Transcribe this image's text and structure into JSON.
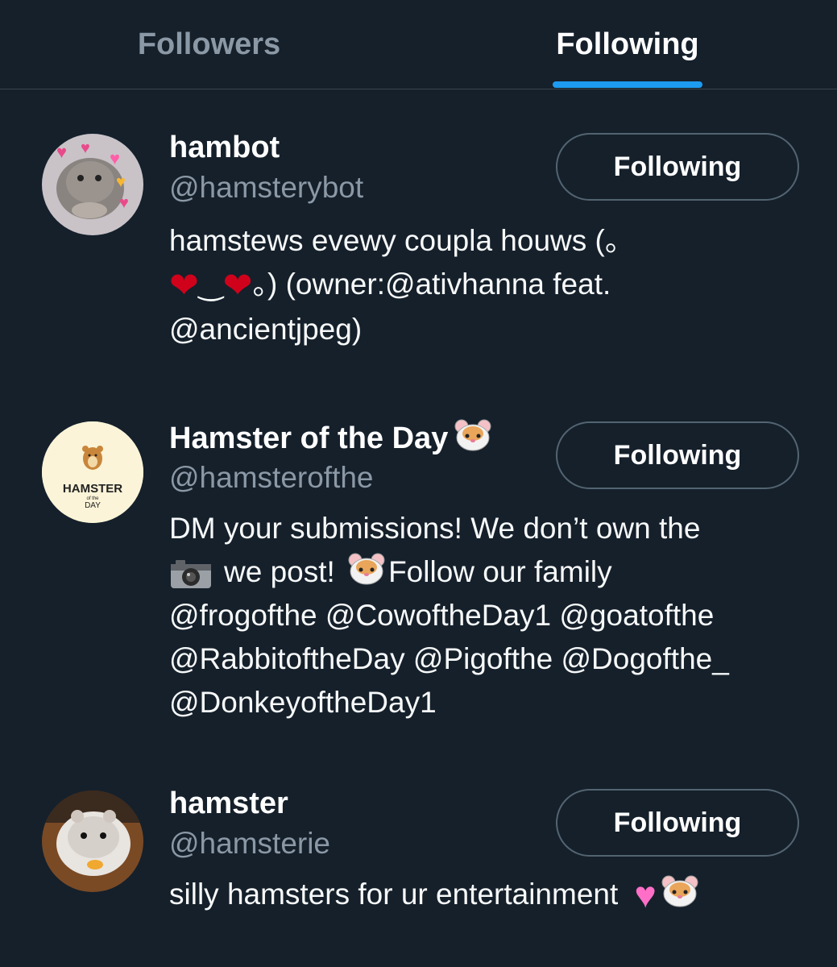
{
  "tabs": {
    "followers": "Followers",
    "following": "Following"
  },
  "users": [
    {
      "name": "hambot",
      "handle": "@hamsterybot",
      "button": "Following",
      "bio_line1": "hamstews evewy coupla houws (。",
      "bio_line2_rest": "。) (owner:@ativhanna feat.",
      "bio_line3": "@ancientjpeg)"
    },
    {
      "name": "Hamster of the Day",
      "handle": "@hamsterofthe",
      "button": "Following",
      "avatar_title": "HAMSTER",
      "avatar_small": "of the",
      "avatar_day": "DAY",
      "bio_line1": "DM your submissions! We don’t own the",
      "bio_line2a": "we post!",
      "bio_line2b": "Follow our family",
      "bio_line3": "@frogofthe @CowoftheDay1 @goatofthe",
      "bio_line4": "@RabbitoftheDay @Pigofthe @Dogofthe_",
      "bio_line5": "@DonkeyoftheDay1"
    },
    {
      "name": "hamster",
      "handle": "@hamsterie",
      "button": "Following",
      "bio": "silly hamsters for ur entertainment"
    }
  ],
  "colors": {
    "background": "#15202b",
    "accent": "#1d9bf0",
    "secondary_text": "#8b98a5"
  }
}
